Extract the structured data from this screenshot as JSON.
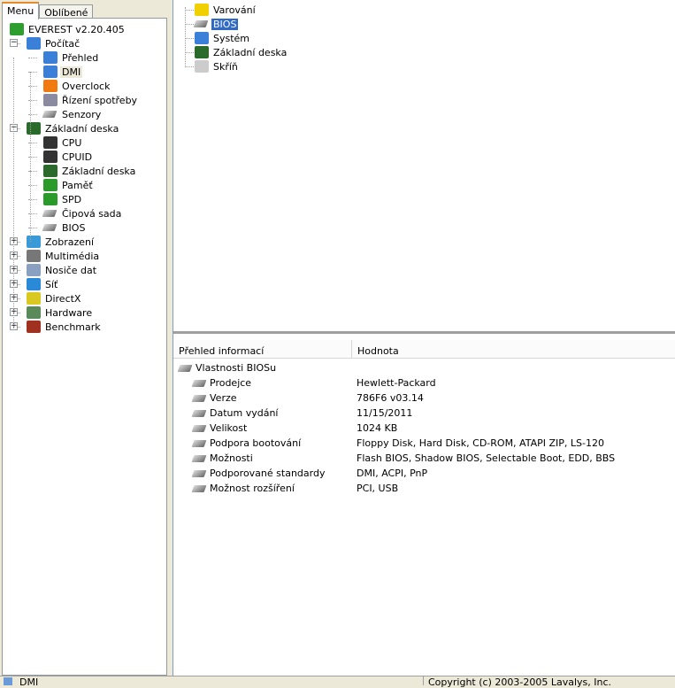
{
  "tabs": [
    "Menu",
    "Oblíbené"
  ],
  "left_tree": [
    {
      "label": "EVEREST v2.20.405",
      "icon": "everest-info-icon",
      "level": 0,
      "color": "#2e9e2e"
    },
    {
      "label": "Počítač",
      "icon": "computer-icon",
      "level": 1,
      "exp": "-",
      "color": "#3a7fd8"
    },
    {
      "label": "Přehled",
      "icon": "computer-icon",
      "level": 2,
      "color": "#3a7fd8"
    },
    {
      "label": "DMI",
      "icon": "computer-icon",
      "level": 2,
      "color": "#3a7fd8",
      "selected": true
    },
    {
      "label": "Overclock",
      "icon": "flame-icon",
      "level": 2,
      "color": "#f07a10"
    },
    {
      "label": "Řízení spotřeby",
      "icon": "power-management-icon",
      "level": 2,
      "color": "#8a8aa0"
    },
    {
      "label": "Senzory",
      "icon": "chip-icon",
      "level": 2,
      "color": "#888"
    },
    {
      "label": "Základní deska",
      "icon": "motherboard-icon",
      "level": 1,
      "exp": "-",
      "color": "#2a6a2a"
    },
    {
      "label": "CPU",
      "icon": "cpu-icon",
      "level": 2,
      "color": "#333"
    },
    {
      "label": "CPUID",
      "icon": "cpu-icon",
      "level": 2,
      "color": "#333"
    },
    {
      "label": "Základní deska",
      "icon": "motherboard-icon",
      "level": 2,
      "color": "#2a6a2a"
    },
    {
      "label": "Paměť",
      "icon": "memory-icon",
      "level": 2,
      "color": "#2a9a2a"
    },
    {
      "label": "SPD",
      "icon": "memory-icon",
      "level": 2,
      "color": "#2a9a2a"
    },
    {
      "label": "Čipová sada",
      "icon": "chip-icon",
      "level": 2,
      "color": "#888"
    },
    {
      "label": "BIOS",
      "icon": "chip-icon",
      "level": 2,
      "color": "#888"
    },
    {
      "label": "Zobrazení",
      "icon": "display-icon",
      "level": 1,
      "exp": "+",
      "color": "#3a9ad8"
    },
    {
      "label": "Multimédia",
      "icon": "speaker-icon",
      "level": 1,
      "exp": "+",
      "color": "#777"
    },
    {
      "label": "Nosiče dat",
      "icon": "storage-icon",
      "level": 1,
      "exp": "+",
      "color": "#8aa0c0"
    },
    {
      "label": "Síť",
      "icon": "network-globe-icon",
      "level": 1,
      "exp": "+",
      "color": "#2a8ad8"
    },
    {
      "label": "DirectX",
      "icon": "directx-icon",
      "level": 1,
      "exp": "+",
      "color": "#d8c820"
    },
    {
      "label": "Hardware",
      "icon": "hardware-icon",
      "level": 1,
      "exp": "+",
      "color": "#5a8a5a"
    },
    {
      "label": "Benchmark",
      "icon": "hourglass-icon",
      "level": 1,
      "exp": "+",
      "color": "#a03020"
    }
  ],
  "right_tree": [
    {
      "label": "Varování",
      "icon": "warning-icon",
      "color": "#f0d000"
    },
    {
      "label": "BIOS",
      "icon": "chip-icon",
      "color": "#888",
      "selected": true
    },
    {
      "label": "Systém",
      "icon": "computer-icon",
      "color": "#3a7fd8"
    },
    {
      "label": "Základní deska",
      "icon": "motherboard-icon",
      "color": "#2a6a2a"
    },
    {
      "label": "Skříň",
      "icon": "case-icon",
      "color": "#ccc"
    }
  ],
  "list": {
    "columns": [
      "Přehled informací",
      "Hodnota"
    ],
    "group": "Vlastnosti BIOSu",
    "rows": [
      {
        "field": "Prodejce",
        "value": "Hewlett-Packard"
      },
      {
        "field": "Verze",
        "value": "786F6 v03.14"
      },
      {
        "field": "Datum vydání",
        "value": "11/15/2011"
      },
      {
        "field": "Velikost",
        "value": "1024 KB"
      },
      {
        "field": "Podpora bootování",
        "value": "Floppy Disk, Hard Disk, CD-ROM, ATAPI ZIP, LS-120"
      },
      {
        "field": "Možnosti",
        "value": "Flash BIOS, Shadow BIOS, Selectable Boot, EDD, BBS"
      },
      {
        "field": "Podporované standardy",
        "value": "DMI, ACPI, PnP"
      },
      {
        "field": "Možnost rozšíření",
        "value": "PCI, USB"
      }
    ]
  },
  "status": {
    "left": "DMI",
    "right": "Copyright (c) 2003-2005 Lavalys, Inc."
  }
}
